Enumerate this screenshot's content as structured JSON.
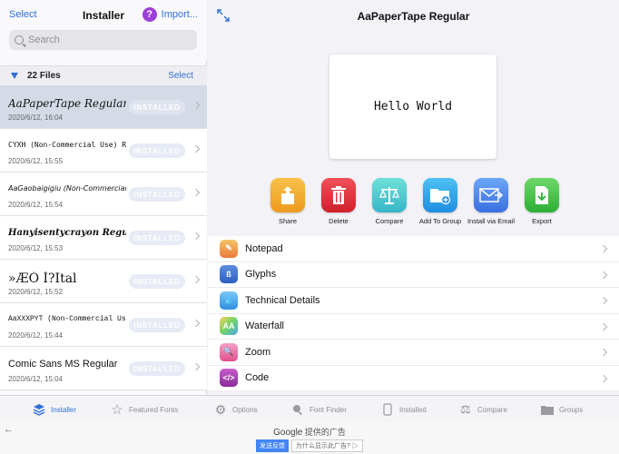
{
  "left_header": {
    "select_label": "Select",
    "title": "Installer",
    "import_label": "Import..."
  },
  "search": {
    "placeholder": "Search"
  },
  "files_header": {
    "count": "22 Files",
    "select_label": "Select"
  },
  "files": [
    {
      "name": "AaPaperTape Regular",
      "date": "2020/6/12, 16:04",
      "status": "INSTALLED",
      "selected": true
    },
    {
      "name": "CYXH (Non-Commercial Use) Regular",
      "date": "2020/6/12, 15:55",
      "status": "INSTALLED"
    },
    {
      "name": "AaGaobaigigiu (Non-Commercial Use ...",
      "date": "2020/6/12, 15:54",
      "status": "INSTALLED"
    },
    {
      "name": "Hanyisentycrayon Regular",
      "date": "2020/6/12, 15:53",
      "status": "INSTALLED"
    },
    {
      "name": "»ÆÓ Í?Ital",
      "date": "2020/6/12, 15:52",
      "status": "INSTALLED"
    },
    {
      "name": "AaXXXPYT (Non-Commercial Use...",
      "date": "2020/6/12, 15:44",
      "status": "INSTALLED"
    },
    {
      "name": "Comic Sans MS Regular",
      "date": "2020/6/12, 15:04",
      "status": "INSTALLED"
    }
  ],
  "detail": {
    "title": "AaPaperTape Regular",
    "preview_text": "Hello World"
  },
  "actions": [
    {
      "label": "Share",
      "color": "#f4a72c"
    },
    {
      "label": "Delete",
      "color": "#e0303a"
    },
    {
      "label": "Compare",
      "color": "#4fd1c9"
    },
    {
      "label": "Add To Group",
      "color": "#35a8ea"
    },
    {
      "label": "Install via Email",
      "color": "#4f8ef0"
    },
    {
      "label": "Export",
      "color": "#45c04a"
    }
  ],
  "menu": [
    {
      "label": "Notepad",
      "icon": "pencil-icon",
      "color": "#f0a050"
    },
    {
      "label": "Glyphs",
      "icon": "glyph-icon",
      "color": "#3d6ecf"
    },
    {
      "label": "Technical Details",
      "icon": "drop-icon",
      "color": "#3a9ae8"
    },
    {
      "label": "Waterfall",
      "icon": "waterfall-icon",
      "color": "#7dd36b"
    },
    {
      "label": "Zoom",
      "icon": "zoom-icon",
      "color": "#e8609e"
    },
    {
      "label": "Code",
      "icon": "code-icon",
      "color": "#b03fb2"
    }
  ],
  "tabs": [
    {
      "label": "Installer",
      "active": true
    },
    {
      "label": "Featured Fonts"
    },
    {
      "label": "Options"
    },
    {
      "label": "Font Finder"
    },
    {
      "label": "Installed"
    },
    {
      "label": "Compare"
    },
    {
      "label": "Groups"
    }
  ],
  "ad": {
    "google": "Google",
    "provided": "提供的广告",
    "feedback": "发送反馈",
    "why": "为什么显示此广告?"
  },
  "accent_color": "#2f6fd6"
}
